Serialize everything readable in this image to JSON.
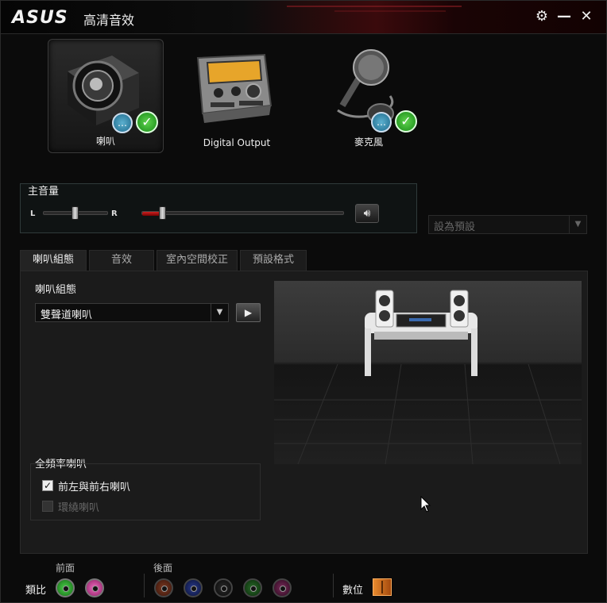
{
  "titlebar": {
    "logo": "ASUS",
    "title": "高清音效",
    "settings_glyph": "⚙",
    "minimize_glyph": "—",
    "close_glyph": "✕"
  },
  "devices": [
    {
      "label": "喇叭",
      "icon": "speaker-icon",
      "selected": true,
      "badges": [
        "chat-icon",
        "check-icon"
      ]
    },
    {
      "label": "Digital Output",
      "icon": "digital-output-icon",
      "selected": false,
      "badges": []
    },
    {
      "label": "麥克風",
      "icon": "microphone-icon",
      "selected": false,
      "badges": [
        "chat-icon",
        "check-icon"
      ]
    }
  ],
  "master_volume": {
    "title": "主音量",
    "balance_left": "L",
    "balance_right": "R",
    "balance": 0.5,
    "volume_percent": 10
  },
  "preset": {
    "placeholder": "設為預設"
  },
  "tabs": [
    "喇叭組態",
    "音效",
    "室內空間校正",
    "預設格式"
  ],
  "speaker_config": {
    "label": "喇叭組態",
    "selected": "雙聲道喇叭"
  },
  "fullrange": {
    "title": "全頻率喇叭",
    "front": {
      "label": "前左與前右喇叭",
      "checked": true
    },
    "surround": {
      "label": "環繞喇叭",
      "checked": false,
      "disabled": true
    }
  },
  "footer": {
    "front_label": "前面",
    "rear_label": "後面",
    "analog_label": "類比",
    "digital_label": "數位",
    "front_jack_colors": [
      "#2a9a2a",
      "#d23c9a"
    ],
    "rear_jack_colors": [
      "#6a2a1a",
      "#1a2a6a",
      "#1a1a1a",
      "#1e5a1e",
      "#6a2a4a"
    ]
  },
  "colors": {
    "accent_red": "#b01e24",
    "check_green": "#2fa82f",
    "chat_blue": "#3b8fb5"
  }
}
